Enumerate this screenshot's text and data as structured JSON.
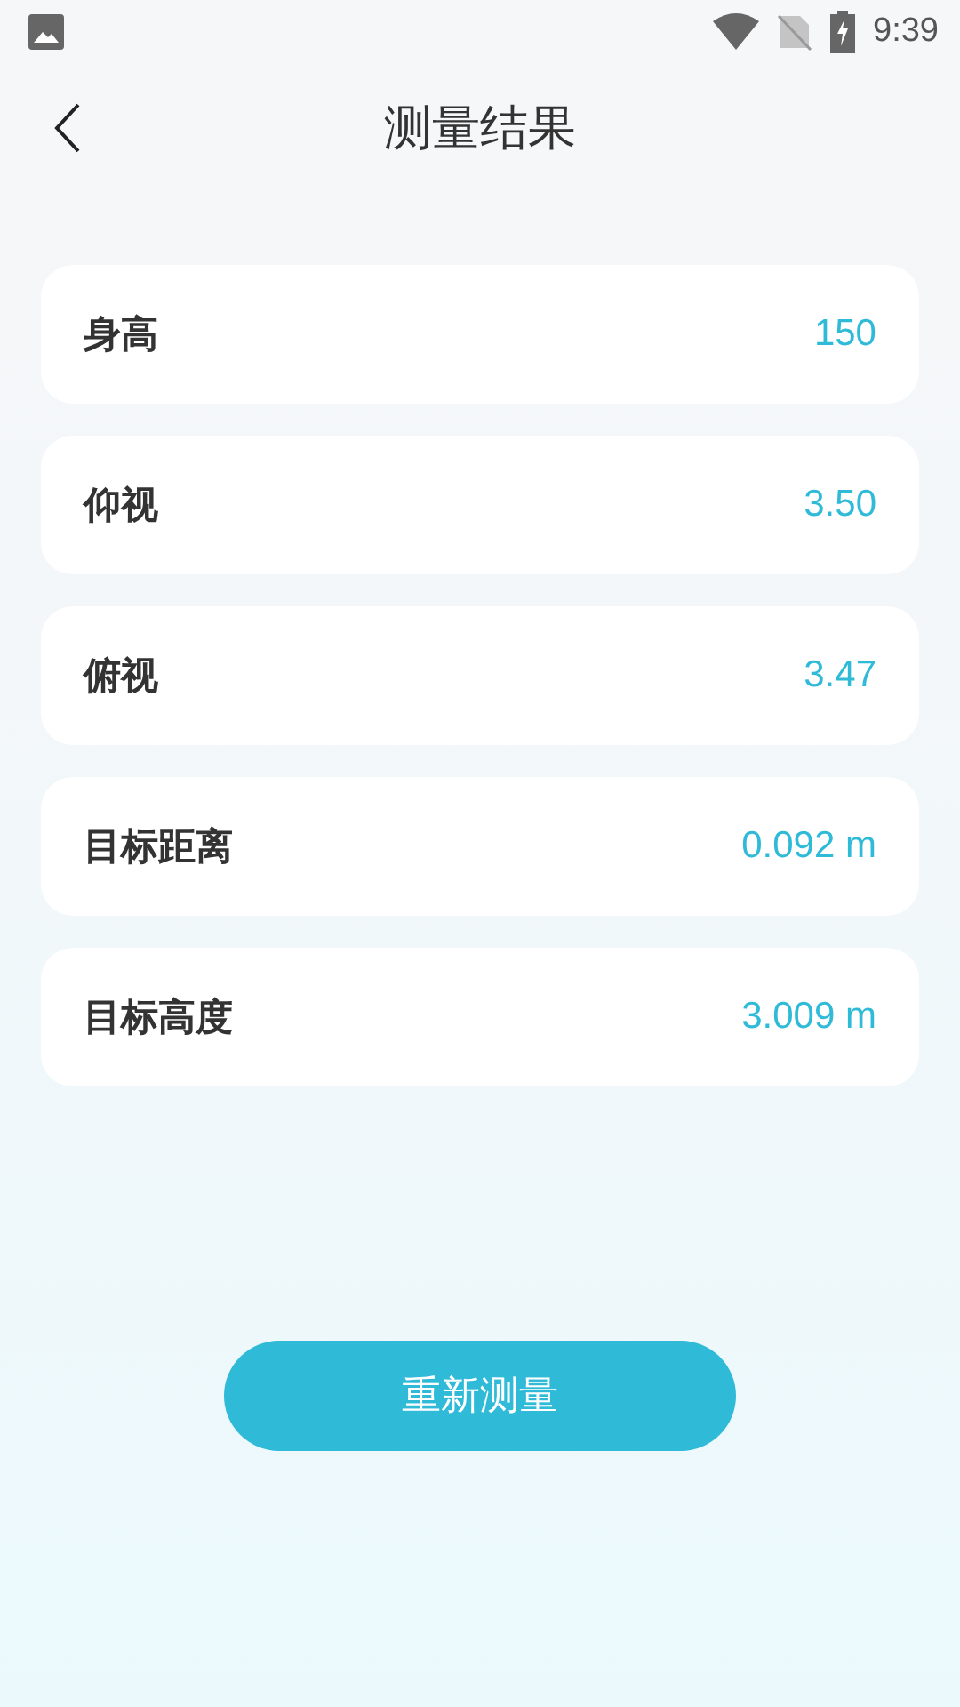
{
  "status_bar": {
    "time": "9:39"
  },
  "header": {
    "title": "测量结果"
  },
  "results": [
    {
      "label": "身高",
      "value": "150"
    },
    {
      "label": "仰视",
      "value": "3.50"
    },
    {
      "label": "俯视",
      "value": "3.47"
    },
    {
      "label": "目标距离",
      "value": "0.092 m"
    },
    {
      "label": "目标高度",
      "value": "3.009 m"
    }
  ],
  "buttons": [
    "重新测量"
  ]
}
